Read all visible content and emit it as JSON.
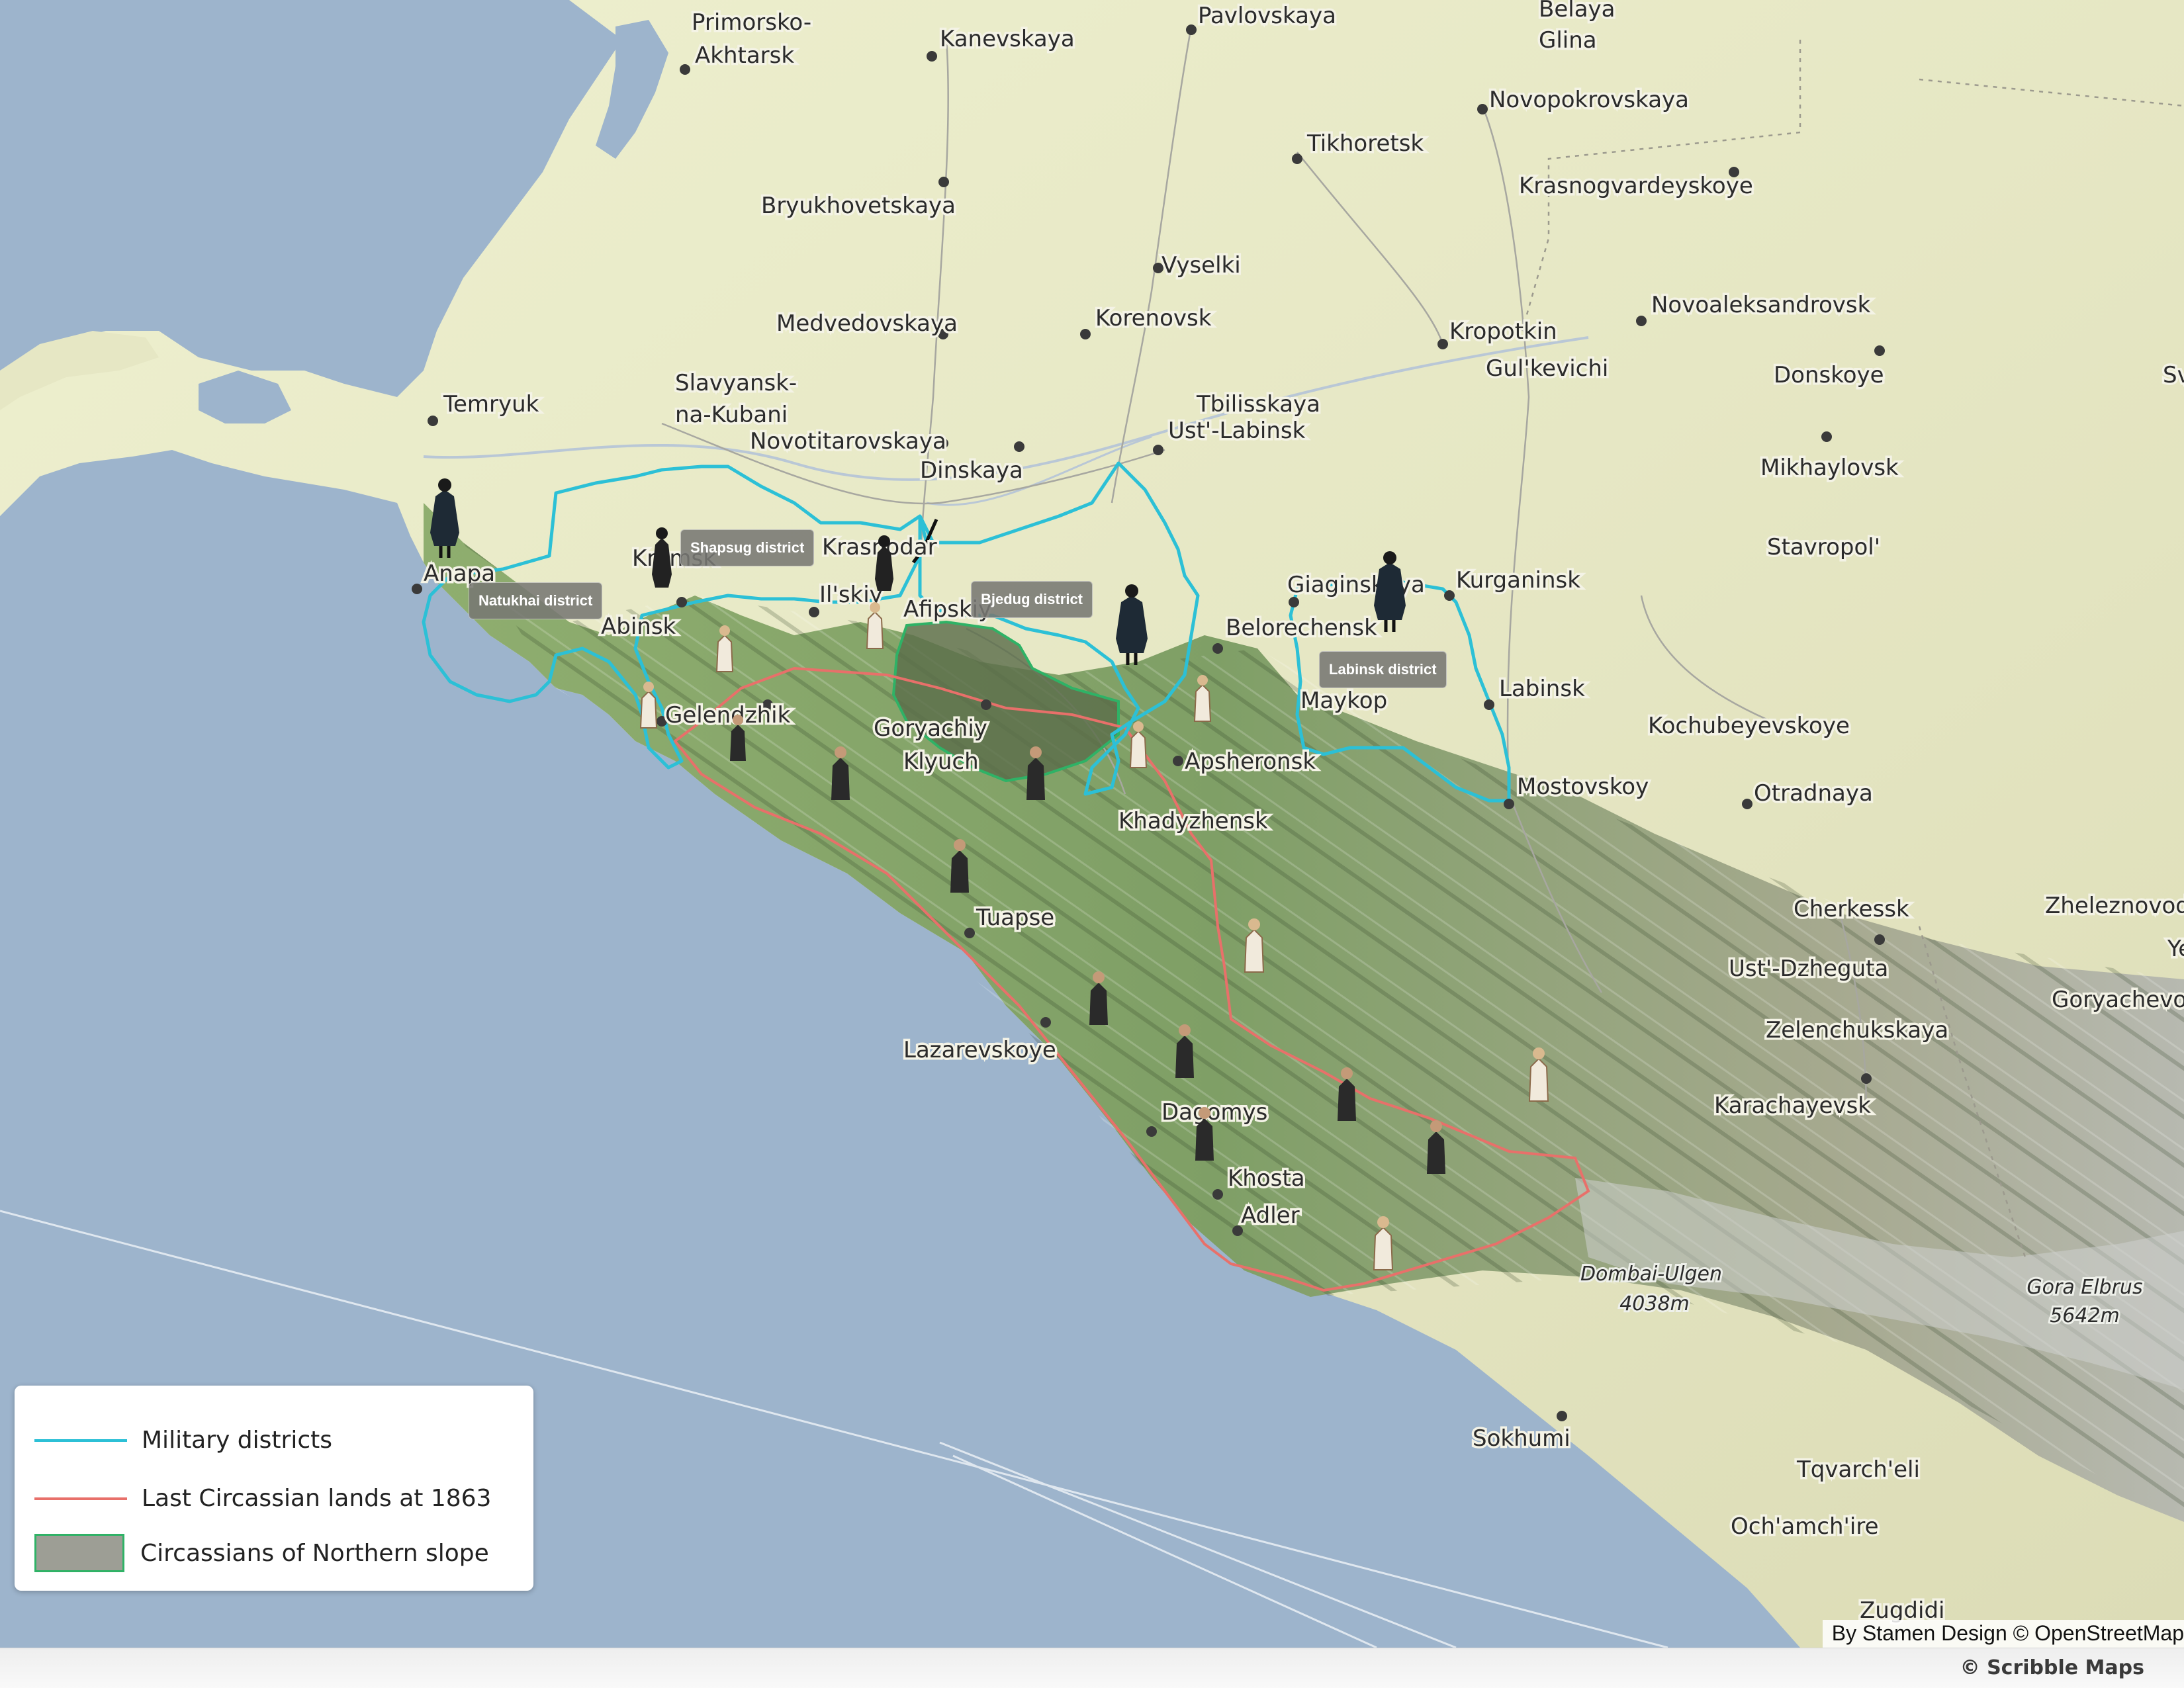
{
  "map": {
    "cities": [
      {
        "name": "Primorsko-"
      },
      {
        "name": "Akhtarsk"
      },
      {
        "name": "Kanevskaya"
      },
      {
        "name": "Pavlovskaya"
      },
      {
        "name": "Belaya"
      },
      {
        "name": "Glina"
      },
      {
        "name": "Novopokrovskaya"
      },
      {
        "name": "Tikhoretsk"
      },
      {
        "name": "Krasnogvardeyskoye"
      },
      {
        "name": "Bryukhovetskaya"
      },
      {
        "name": "Vyselki"
      },
      {
        "name": "Novoaleksandrovsk"
      },
      {
        "name": "Medvedovskaya"
      },
      {
        "name": "Korenovsk"
      },
      {
        "name": "Kropotkin"
      },
      {
        "name": "Gul'kevichi"
      },
      {
        "name": "Donskoye"
      },
      {
        "name": "Slavyansk-"
      },
      {
        "name": "na-Kubani"
      },
      {
        "name": "Temryuk"
      },
      {
        "name": "Tbilisskaya"
      },
      {
        "name": "Ust'-Labinsk"
      },
      {
        "name": "Novotitarovskaya"
      },
      {
        "name": "Dinskaya"
      },
      {
        "name": "Mikhaylovsk"
      },
      {
        "name": "Krasnodar"
      },
      {
        "name": "Stavropol'"
      },
      {
        "name": "Anapa"
      },
      {
        "name": "Krymsk"
      },
      {
        "name": "Giaginskaya"
      },
      {
        "name": "Kurganinsk"
      },
      {
        "name": "Il'skiy"
      },
      {
        "name": "Afipskiy"
      },
      {
        "name": "Abinsk"
      },
      {
        "name": "Belorechensk"
      },
      {
        "name": "Labinsk"
      },
      {
        "name": "Maykop"
      },
      {
        "name": "Gelendzhik"
      },
      {
        "name": "Goryachiy"
      },
      {
        "name": "Klyuch"
      },
      {
        "name": "Kochubeyevskoye"
      },
      {
        "name": "Apsheronsk"
      },
      {
        "name": "Mostovskoy"
      },
      {
        "name": "Otradnaya"
      },
      {
        "name": "Khadyzhensk"
      },
      {
        "name": "Tuapse"
      },
      {
        "name": "Cherkessk"
      },
      {
        "name": "Zheleznovods"
      },
      {
        "name": "Ust'-Dzheguta"
      },
      {
        "name": "Ye"
      },
      {
        "name": "Goryachevod"
      },
      {
        "name": "Lazarevskoye"
      },
      {
        "name": "Zelenchukskaya"
      },
      {
        "name": "Karachayevsk"
      },
      {
        "name": "Dagomys"
      },
      {
        "name": "Khosta"
      },
      {
        "name": "Adler"
      },
      {
        "name": "Sokhumi"
      },
      {
        "name": "Tqvarch'eli"
      },
      {
        "name": "Och'amch'ire"
      },
      {
        "name": "Zugdidi"
      },
      {
        "name": "Sv"
      }
    ],
    "peaks": [
      {
        "name": "Dombai-Ulgen",
        "elevation": "4038m"
      },
      {
        "name": "Gora Elbrus",
        "elevation": "5642m"
      }
    ],
    "districts": {
      "shapsug": "Shapsug district",
      "natukhai": "Natukhai district",
      "bjedug": "Bjedug district",
      "labinsk": "Labinsk district"
    },
    "colors": {
      "sea": "#9db4cc",
      "military_districts": "#2cc0d6",
      "last_lands": "#e8706a",
      "northern_slope_fill": "#5b6e4a",
      "northern_slope_border": "#2fb266"
    }
  },
  "legend": {
    "items": [
      {
        "label": "Military districts",
        "color": "#2cc0d6",
        "swatch": "line"
      },
      {
        "label": "Last Circassian lands at 1863",
        "color": "#e8706a",
        "swatch": "line"
      },
      {
        "label": "Circassians of Northern slope",
        "color": "#9d9e95",
        "swatch": "box"
      }
    ]
  },
  "attribution": "By Stamen Design © OpenStreetMap",
  "footer": {
    "brand": "© Scribble Maps"
  }
}
